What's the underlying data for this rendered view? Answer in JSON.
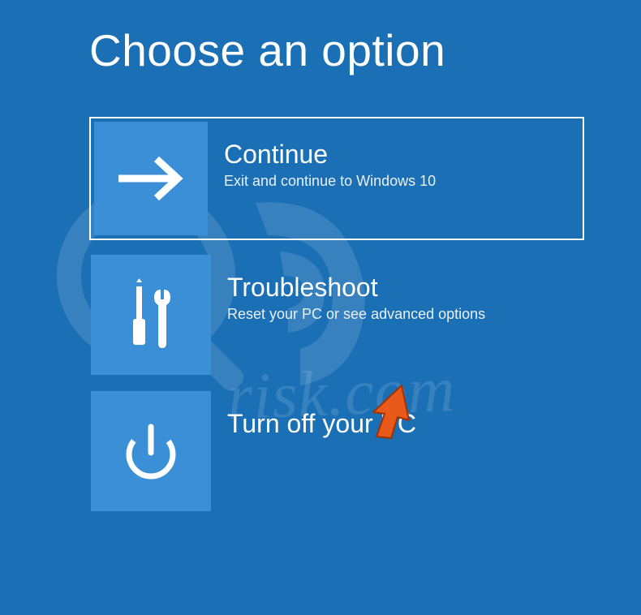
{
  "page": {
    "title": "Choose an option"
  },
  "options": [
    {
      "title": "Continue",
      "description": "Exit and continue to Windows 10",
      "icon": "arrow-right",
      "selected": true
    },
    {
      "title": "Troubleshoot",
      "description": "Reset your PC or see advanced options",
      "icon": "tools",
      "selected": false
    },
    {
      "title": "Turn off your PC",
      "description": "",
      "icon": "power",
      "selected": false
    }
  ],
  "watermark": "risk.com",
  "colors": {
    "background": "#1a6fb5",
    "tile": "#3a8fd6",
    "pointer": "#e85a1a"
  }
}
